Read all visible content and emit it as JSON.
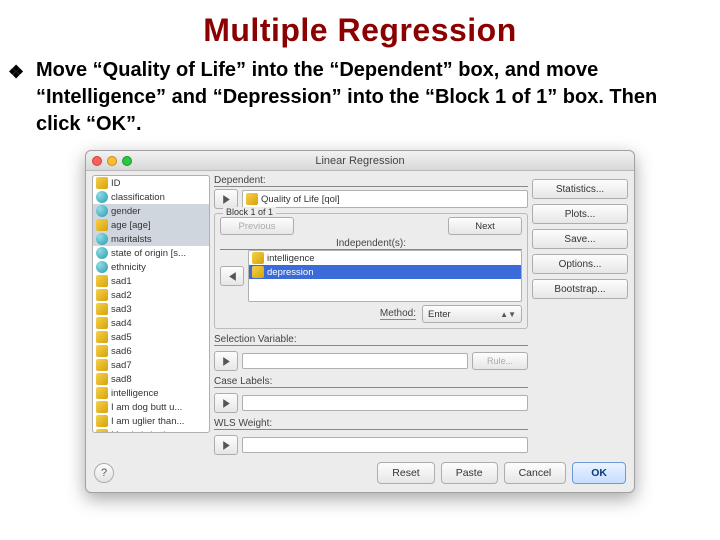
{
  "slide": {
    "title": "Multiple Regression",
    "bullet": "❖",
    "instruction": "Move “Quality of Life” into the “Dependent” box, and move “Intelligence” and “Depression” into the “Block 1 of 1” box. Then click “OK”."
  },
  "dialog": {
    "title": "Linear Regression",
    "labels": {
      "dependent": "Dependent:",
      "block": "Block 1 of 1",
      "previous": "Previous",
      "next": "Next",
      "independents": "Independent(s):",
      "method": "Method:",
      "method_value": "Enter",
      "selection_variable": "Selection Variable:",
      "rule": "Rule...",
      "case_labels": "Case Labels:",
      "wls_weight": "WLS Weight:"
    },
    "dependent_value": "Quality of Life [qol]",
    "independents": [
      "intelligence",
      "depression"
    ],
    "selected_independent_index": 1,
    "variables": [
      {
        "type": "scale",
        "label": "ID"
      },
      {
        "type": "nom",
        "label": "classification"
      },
      {
        "type": "nom",
        "label": "gender",
        "sel": true
      },
      {
        "type": "scale",
        "label": "age [age]",
        "sel": true
      },
      {
        "type": "nom",
        "label": "maritalsts",
        "sel": true
      },
      {
        "type": "nom",
        "label": "state of origin [s..."
      },
      {
        "type": "nom",
        "label": "ethnicity"
      },
      {
        "type": "scale",
        "label": "sad1"
      },
      {
        "type": "scale",
        "label": "sad2"
      },
      {
        "type": "scale",
        "label": "sad3"
      },
      {
        "type": "scale",
        "label": "sad4"
      },
      {
        "type": "scale",
        "label": "sad5"
      },
      {
        "type": "scale",
        "label": "sad6"
      },
      {
        "type": "scale",
        "label": "sad7"
      },
      {
        "type": "scale",
        "label": "sad8"
      },
      {
        "type": "scale",
        "label": "intelligence"
      },
      {
        "type": "scale",
        "label": "I am dog butt u..."
      },
      {
        "type": "scale",
        "label": "I am uglier than..."
      },
      {
        "type": "scale",
        "label": "My pic is in the"
      }
    ],
    "side_buttons": {
      "statistics": "Statistics...",
      "plots": "Plots...",
      "save": "Save...",
      "options": "Options...",
      "bootstrap": "Bootstrap..."
    },
    "footer": {
      "help": "?",
      "reset": "Reset",
      "paste": "Paste",
      "cancel": "Cancel",
      "ok": "OK"
    }
  }
}
